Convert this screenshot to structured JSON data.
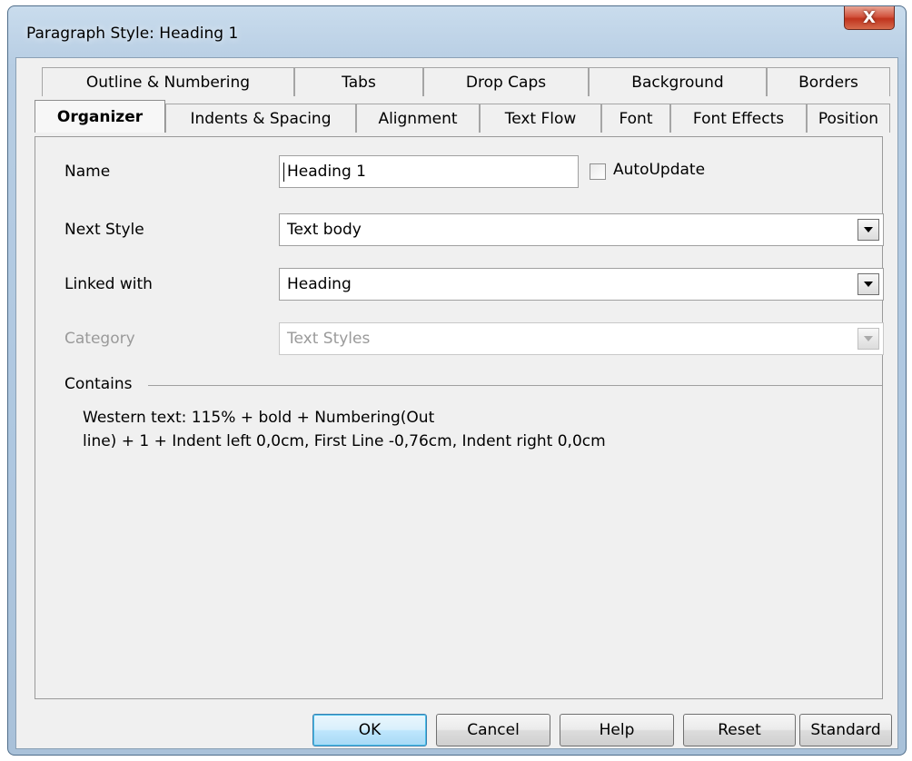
{
  "window": {
    "title": "Paragraph Style: Heading 1",
    "close_symbol": "X"
  },
  "tabs_row1": [
    "Outline & Numbering",
    "Tabs",
    "Drop Caps",
    "Background",
    "Borders"
  ],
  "tabs_row2": [
    "Organizer",
    "Indents & Spacing",
    "Alignment",
    "Text Flow",
    "Font",
    "Font Effects",
    "Position"
  ],
  "active_tab": "Organizer",
  "form": {
    "name_label": "Name",
    "name_value": "Heading 1",
    "autoupdate_label": "AutoUpdate",
    "autoupdate_checked": false,
    "next_style_label": "Next Style",
    "next_style_value": "Text body",
    "linked_with_label": "Linked with",
    "linked_with_value": "Heading",
    "category_label": "Category",
    "category_value": "Text Styles"
  },
  "contains": {
    "label": "Contains",
    "line1": "Western text: 115% + bold + Numbering(Out",
    "line2": "line) + 1 + Indent left 0,0cm, First Line -0,76cm, Indent right 0,0cm"
  },
  "buttons": {
    "ok": "OK",
    "cancel": "Cancel",
    "help": "Help",
    "reset": "Reset",
    "standard": "Standard"
  },
  "colors": {
    "frame": "#b7cde3",
    "close_button": "#c0341e",
    "default_button_border": "#3c7fb1"
  }
}
